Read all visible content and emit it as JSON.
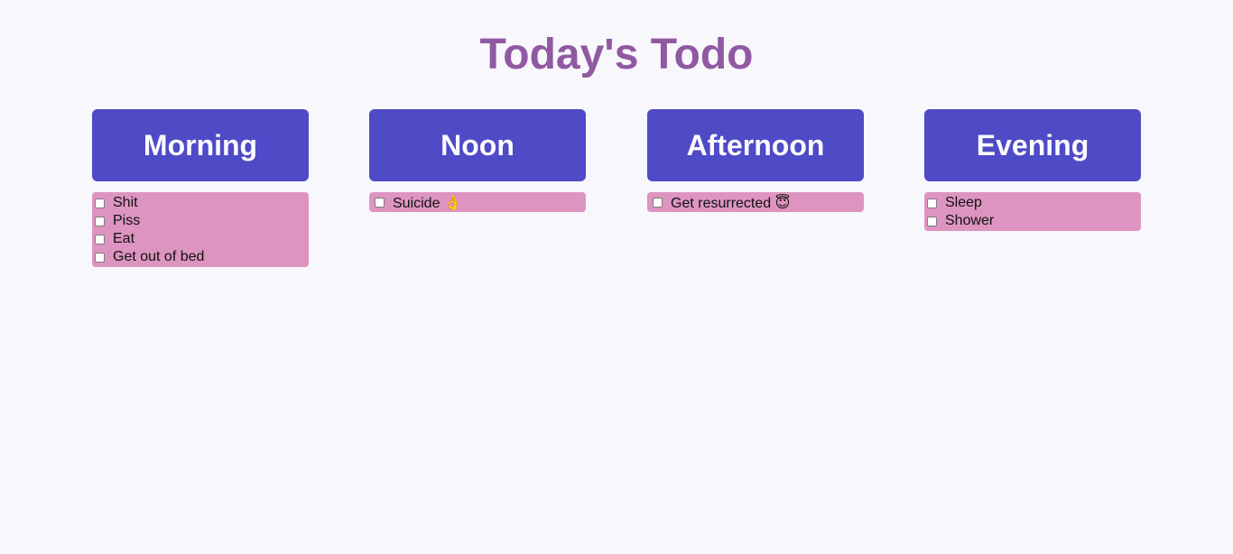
{
  "header": {
    "title": "Today's Todo"
  },
  "columns": [
    {
      "title": "Morning",
      "items": [
        "Shit",
        "Piss",
        "Eat",
        "Get out of bed"
      ]
    },
    {
      "title": "Noon",
      "items": [
        "Suicide 👌"
      ]
    },
    {
      "title": "Afternoon",
      "items": [
        "Get resurrected 😇"
      ]
    },
    {
      "title": "Evening",
      "items": [
        "Sleep",
        "Shower"
      ]
    }
  ],
  "colors": {
    "background": "#f8f7fc",
    "title": "#9059a2",
    "column_header": "#4f4ac6",
    "list_background": "#de94c1"
  }
}
